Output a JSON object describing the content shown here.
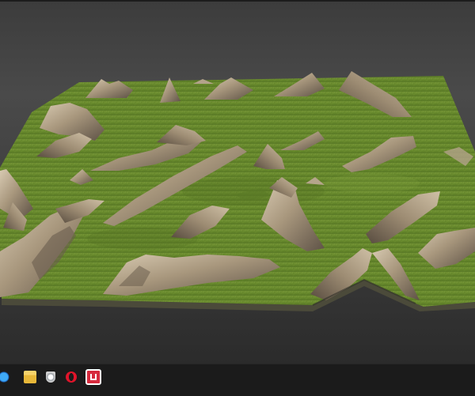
{
  "app": {
    "window_title": "",
    "scene": "terrain-viewport"
  },
  "viewport": {
    "background": "#3a3a3a",
    "terrain_colors": {
      "grass": "#6e8f33",
      "grass_dark": "#4f6c21",
      "rock_light": "#cbbca3",
      "rock_mid": "#9b8b73",
      "rock_dark": "#5b5043",
      "edge": "#4b4a3a"
    }
  },
  "taskbar": {
    "background": "#1b1b1b",
    "icons": [
      {
        "name": "edge-icon",
        "color": "#1e6fd0"
      },
      {
        "name": "file-explorer-icon",
        "color": "#e8b839"
      },
      {
        "name": "security-shield-icon",
        "color": "#9aa0a6"
      },
      {
        "name": "opera-icon",
        "color": "#e0142a"
      },
      {
        "name": "app-icon",
        "color": "#d62a3d"
      }
    ]
  }
}
